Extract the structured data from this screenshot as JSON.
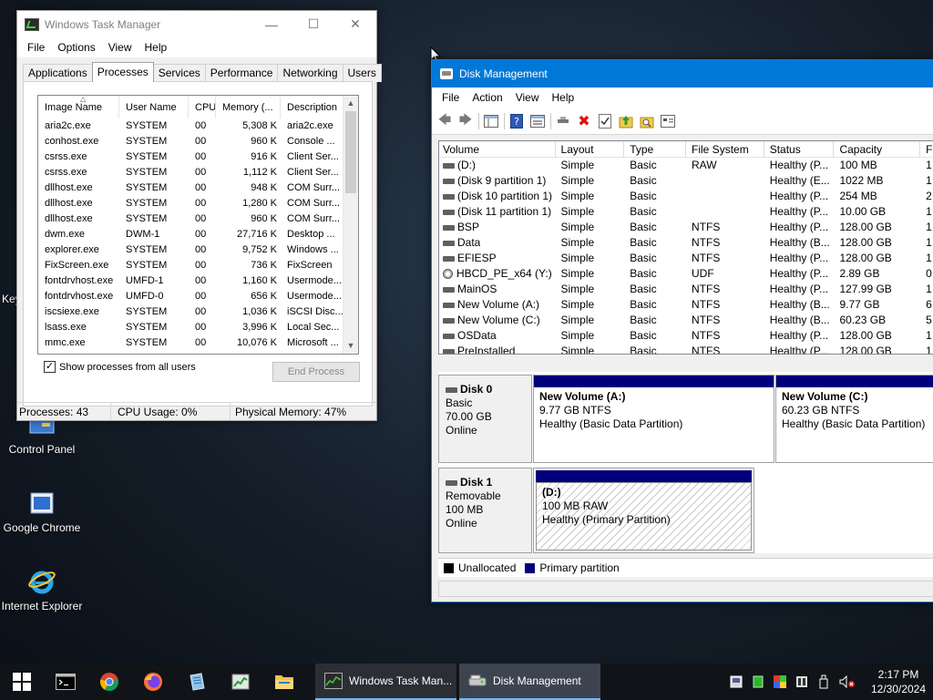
{
  "desktop": {
    "keys_label": "Key",
    "icons": [
      {
        "label": "Control Panel",
        "icon": "control-panel-icon"
      },
      {
        "label": "Google Chrome",
        "icon": "chrome-shortcut-icon"
      },
      {
        "label": "Internet Explorer",
        "icon": "internet-explorer-icon"
      }
    ]
  },
  "task_manager": {
    "title": "Windows Task Manager",
    "menu": [
      "File",
      "Options",
      "View",
      "Help"
    ],
    "tabs": [
      "Applications",
      "Processes",
      "Services",
      "Performance",
      "Networking",
      "Users"
    ],
    "active_tab": "Processes",
    "columns": [
      "Image Name",
      "User Name",
      "CPU",
      "Memory (...",
      "Description"
    ],
    "rows": [
      [
        "aria2c.exe",
        "SYSTEM",
        "00",
        "5,308 K",
        "aria2c.exe"
      ],
      [
        "conhost.exe",
        "SYSTEM",
        "00",
        "960 K",
        "Console ..."
      ],
      [
        "csrss.exe",
        "SYSTEM",
        "00",
        "916 K",
        "Client Ser..."
      ],
      [
        "csrss.exe",
        "SYSTEM",
        "00",
        "1,112 K",
        "Client Ser..."
      ],
      [
        "dllhost.exe",
        "SYSTEM",
        "00",
        "948 K",
        "COM Surr..."
      ],
      [
        "dllhost.exe",
        "SYSTEM",
        "00",
        "1,280 K",
        "COM Surr..."
      ],
      [
        "dllhost.exe",
        "SYSTEM",
        "00",
        "960 K",
        "COM Surr..."
      ],
      [
        "dwm.exe",
        "DWM-1",
        "00",
        "27,716 K",
        "Desktop ..."
      ],
      [
        "explorer.exe",
        "SYSTEM",
        "00",
        "9,752 K",
        "Windows ..."
      ],
      [
        "FixScreen.exe",
        "SYSTEM",
        "00",
        "736 K",
        "FixScreen"
      ],
      [
        "fontdrvhost.exe",
        "UMFD-1",
        "00",
        "1,160 K",
        "Usermode..."
      ],
      [
        "fontdrvhost.exe",
        "UMFD-0",
        "00",
        "656 K",
        "Usermode..."
      ],
      [
        "iscsiexe.exe",
        "SYSTEM",
        "00",
        "1,036 K",
        "iSCSI Disc..."
      ],
      [
        "lsass.exe",
        "SYSTEM",
        "00",
        "3,996 K",
        "Local Sec..."
      ],
      [
        "mmc.exe",
        "SYSTEM",
        "00",
        "10,076 K",
        "Microsoft ..."
      ]
    ],
    "show_all_label": "Show processes from all users",
    "show_all_checked": true,
    "end_process_label": "End Process",
    "status": {
      "processes": "Processes: 43",
      "cpu": "CPU Usage: 0%",
      "memory": "Physical Memory: 47%"
    }
  },
  "disk_management": {
    "title": "Disk Management",
    "menu": [
      "File",
      "Action",
      "View",
      "Help"
    ],
    "columns": [
      "Volume",
      "Layout",
      "Type",
      "File System",
      "Status",
      "Capacity",
      "F"
    ],
    "volumes": [
      {
        "name": "(D:)",
        "layout": "Simple",
        "type": "Basic",
        "fs": "RAW",
        "status": "Healthy (P...",
        "capacity": "100 MB",
        "free": "1",
        "icon": "disk"
      },
      {
        "name": "(Disk 9 partition 1)",
        "layout": "Simple",
        "type": "Basic",
        "fs": "",
        "status": "Healthy (E...",
        "capacity": "1022 MB",
        "free": "1",
        "icon": "disk"
      },
      {
        "name": "(Disk 10 partition 1)",
        "layout": "Simple",
        "type": "Basic",
        "fs": "",
        "status": "Healthy (P...",
        "capacity": "254 MB",
        "free": "2",
        "icon": "disk"
      },
      {
        "name": "(Disk 11 partition 1)",
        "layout": "Simple",
        "type": "Basic",
        "fs": "",
        "status": "Healthy (P...",
        "capacity": "10.00 GB",
        "free": "1",
        "icon": "disk"
      },
      {
        "name": "BSP",
        "layout": "Simple",
        "type": "Basic",
        "fs": "NTFS",
        "status": "Healthy (P...",
        "capacity": "128.00 GB",
        "free": "1",
        "icon": "disk"
      },
      {
        "name": "Data",
        "layout": "Simple",
        "type": "Basic",
        "fs": "NTFS",
        "status": "Healthy (B...",
        "capacity": "128.00 GB",
        "free": "1",
        "icon": "disk"
      },
      {
        "name": "EFIESP",
        "layout": "Simple",
        "type": "Basic",
        "fs": "NTFS",
        "status": "Healthy (P...",
        "capacity": "128.00 GB",
        "free": "1",
        "icon": "disk"
      },
      {
        "name": "HBCD_PE_x64 (Y:)",
        "layout": "Simple",
        "type": "Basic",
        "fs": "UDF",
        "status": "Healthy (P...",
        "capacity": "2.89 GB",
        "free": "0",
        "icon": "cd"
      },
      {
        "name": "MainOS",
        "layout": "Simple",
        "type": "Basic",
        "fs": "NTFS",
        "status": "Healthy (P...",
        "capacity": "127.99 GB",
        "free": "1",
        "icon": "disk"
      },
      {
        "name": "New Volume (A:)",
        "layout": "Simple",
        "type": "Basic",
        "fs": "NTFS",
        "status": "Healthy (B...",
        "capacity": "9.77 GB",
        "free": "6",
        "icon": "disk"
      },
      {
        "name": "New Volume (C:)",
        "layout": "Simple",
        "type": "Basic",
        "fs": "NTFS",
        "status": "Healthy (B...",
        "capacity": "60.23 GB",
        "free": "5",
        "icon": "disk"
      },
      {
        "name": "OSData",
        "layout": "Simple",
        "type": "Basic",
        "fs": "NTFS",
        "status": "Healthy (P...",
        "capacity": "128.00 GB",
        "free": "1",
        "icon": "disk"
      },
      {
        "name": "PreInstalled",
        "layout": "Simple",
        "type": "Basic",
        "fs": "NTFS",
        "status": "Healthy (P...",
        "capacity": "128.00 GB",
        "free": "1",
        "icon": "disk"
      }
    ],
    "disks": [
      {
        "name": "Disk 0",
        "kind": "Basic",
        "size": "70.00 GB",
        "state": "Online",
        "partitions": [
          {
            "name": "New Volume  (A:)",
            "size": "9.77 GB NTFS",
            "status": "Healthy (Basic Data Partition)"
          },
          {
            "name": "New Volume  (C:)",
            "size": "60.23 GB NTFS",
            "status": "Healthy (Basic Data Partition)"
          }
        ]
      },
      {
        "name": "Disk 1",
        "kind": "Removable",
        "size": "100 MB",
        "state": "Online",
        "partitions": [
          {
            "name": "(D:)",
            "size": "100 MB RAW",
            "status": "Healthy (Primary Partition)"
          }
        ]
      }
    ],
    "legend": [
      {
        "label": "Unallocated",
        "color": "#000000"
      },
      {
        "label": "Primary partition",
        "color": "#00007c"
      }
    ]
  },
  "taskbar": {
    "tasks": [
      {
        "label": "Windows Task Man...",
        "icon": "task-manager-icon"
      },
      {
        "label": "Disk Management",
        "icon": "disk-management-icon"
      }
    ],
    "clock": {
      "time": "2:17 PM",
      "date": "12/30/2024"
    }
  },
  "colors": {
    "titlebar_active": "#0078d7",
    "primary_partition": "#00007c",
    "taskbar": "#101317"
  }
}
